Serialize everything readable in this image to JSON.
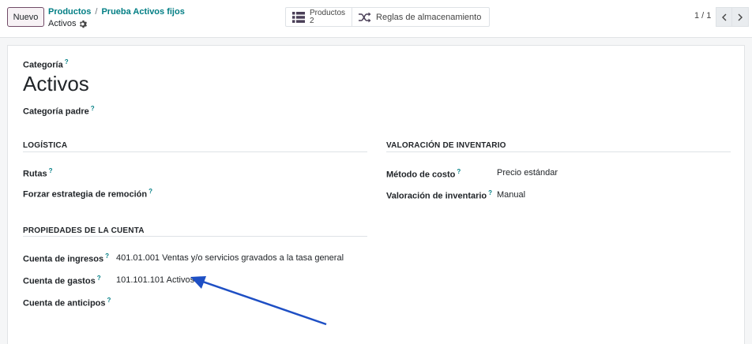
{
  "control_panel": {
    "new_button": "Nuevo",
    "breadcrumb": {
      "parent": "Productos",
      "separator": "/",
      "child": "Prueba Activos fijos",
      "current": "Activos"
    },
    "smart_buttons": {
      "products_label": "Productos",
      "products_count": "2",
      "putaway_label": "Reglas de almacenamiento"
    },
    "pager": {
      "value": "1 / 1"
    }
  },
  "form": {
    "category_label": "Categoría",
    "category_name": "Activos",
    "parent_label": "Categoría padre",
    "help_mark": "?",
    "logistics": {
      "title": "LOGÍSTICA",
      "routes_label": "Rutas",
      "removal_label": "Forzar estrategia de remoción"
    },
    "inventory_valuation": {
      "title": "VALORACIÓN DE INVENTARIO",
      "cost_method_label": "Método de costo",
      "cost_method_value": "Precio estándar",
      "valuation_label": "Valoración de inventario",
      "valuation_value": "Manual"
    },
    "account_properties": {
      "title": "PROPIEDADES DE LA CUENTA",
      "income_label": "Cuenta de ingresos",
      "income_value": "401.01.001 Ventas y/o servicios gravados a la tasa general",
      "expense_label": "Cuenta de gastos",
      "expense_value": "101.101.101 Activos",
      "advance_label": "Cuenta de anticipos"
    }
  },
  "colors": {
    "accent_link": "#017e84",
    "primary": "#714b67",
    "annotation_arrow": "#1e4fc4"
  }
}
